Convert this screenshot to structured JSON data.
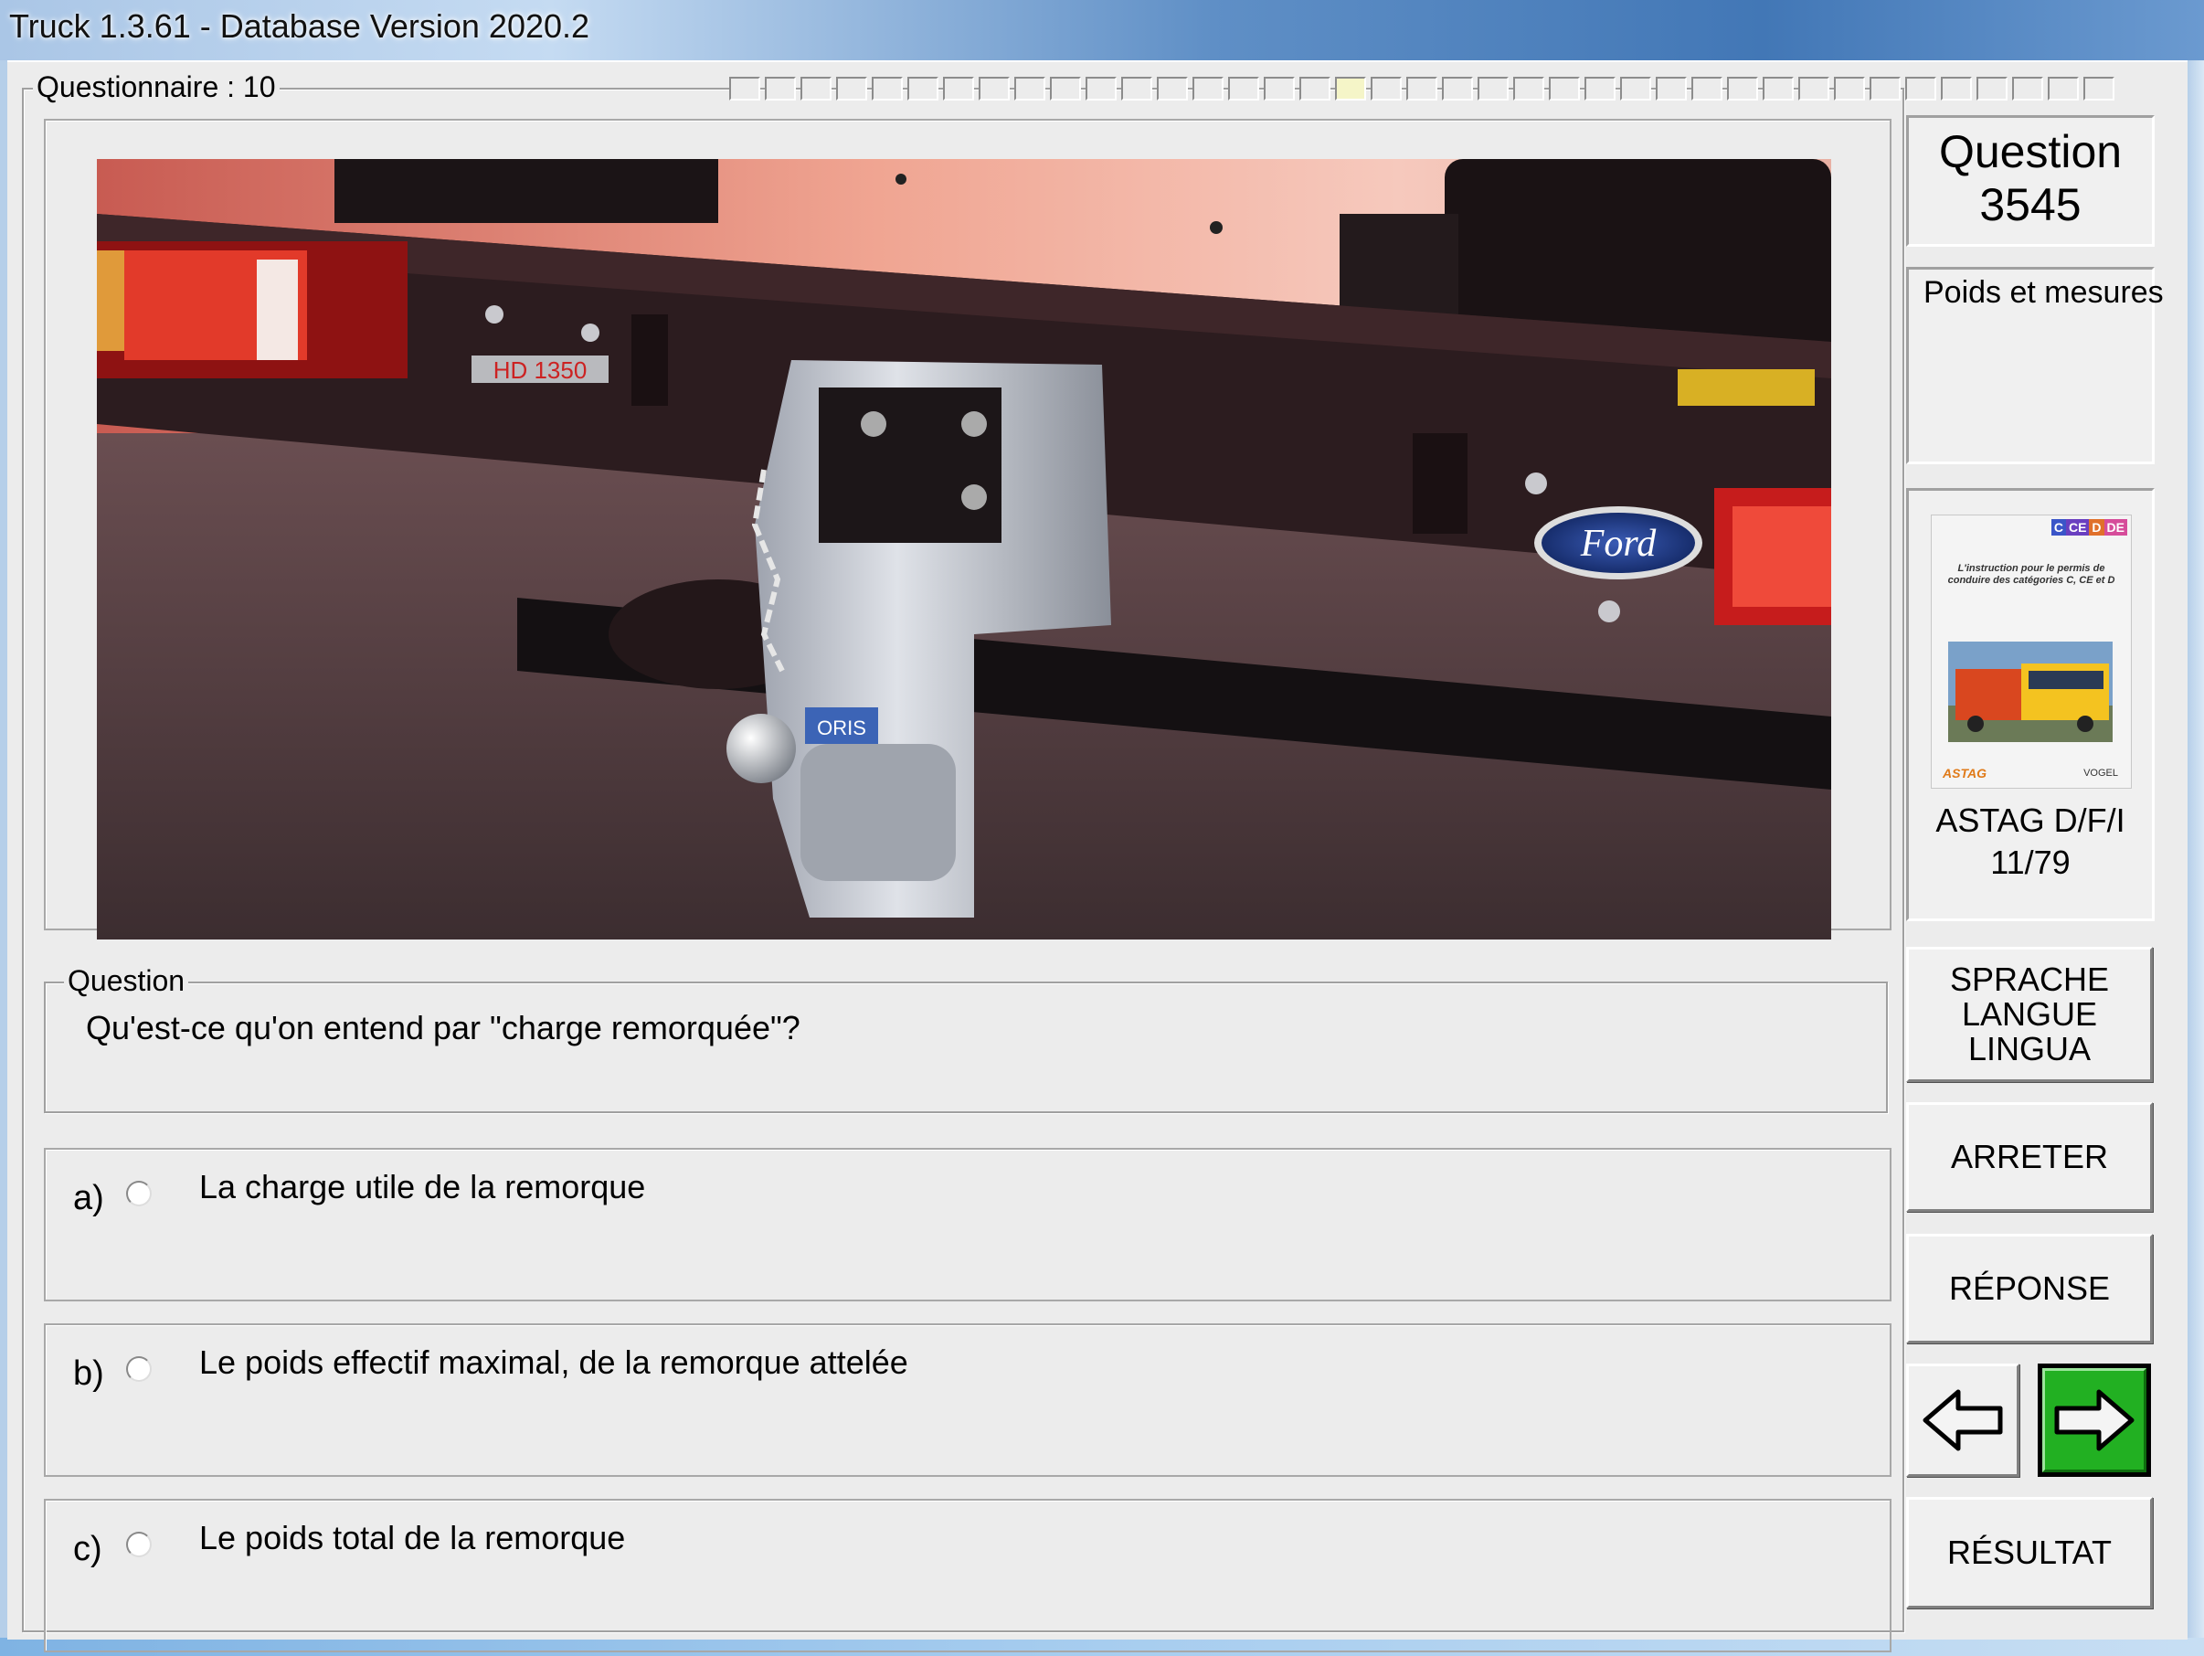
{
  "window": {
    "title": "Truck 1.3.61 - Database Version 2020.2"
  },
  "questionnaire": {
    "label": "Questionnaire : 10",
    "progress": {
      "total_cells": 39,
      "current_index": 17
    }
  },
  "question_header": {
    "title_line1": "Question",
    "number": "3545"
  },
  "category": "Poids et mesures",
  "book": {
    "badges": [
      "C",
      "CE",
      "D",
      "DE"
    ],
    "subtitle": "L'instruction pour le permis de conduire des catégories C, CE et D",
    "publisher_left": "ASTAG",
    "publisher_right": "VOGEL",
    "reference_line1": "ASTAG D/F/I",
    "reference_line2": "11/79"
  },
  "photo": {
    "plate_text": "HD 1350",
    "brand_text": "Ford",
    "hitch_label": "ORIS"
  },
  "question": {
    "legend": "Question",
    "text": "Qu'est-ce qu'on entend par \"charge remorquée\"?"
  },
  "answers": [
    {
      "letter": "a)",
      "text": "La charge utile de la remorque"
    },
    {
      "letter": "b)",
      "text": "Le poids effectif maximal, de la remorque attelée"
    },
    {
      "letter": "c)",
      "text": "Le poids total de la remorque"
    }
  ],
  "buttons": {
    "language_lines": [
      "SPRACHE",
      "LANGUE",
      "LINGUA"
    ],
    "stop": "ARRETER",
    "answer": "RÉPONSE",
    "result": "RÉSULTAT"
  },
  "colors": {
    "next_button_bg": "#22b022",
    "progress_current": "#f5f5c8"
  }
}
